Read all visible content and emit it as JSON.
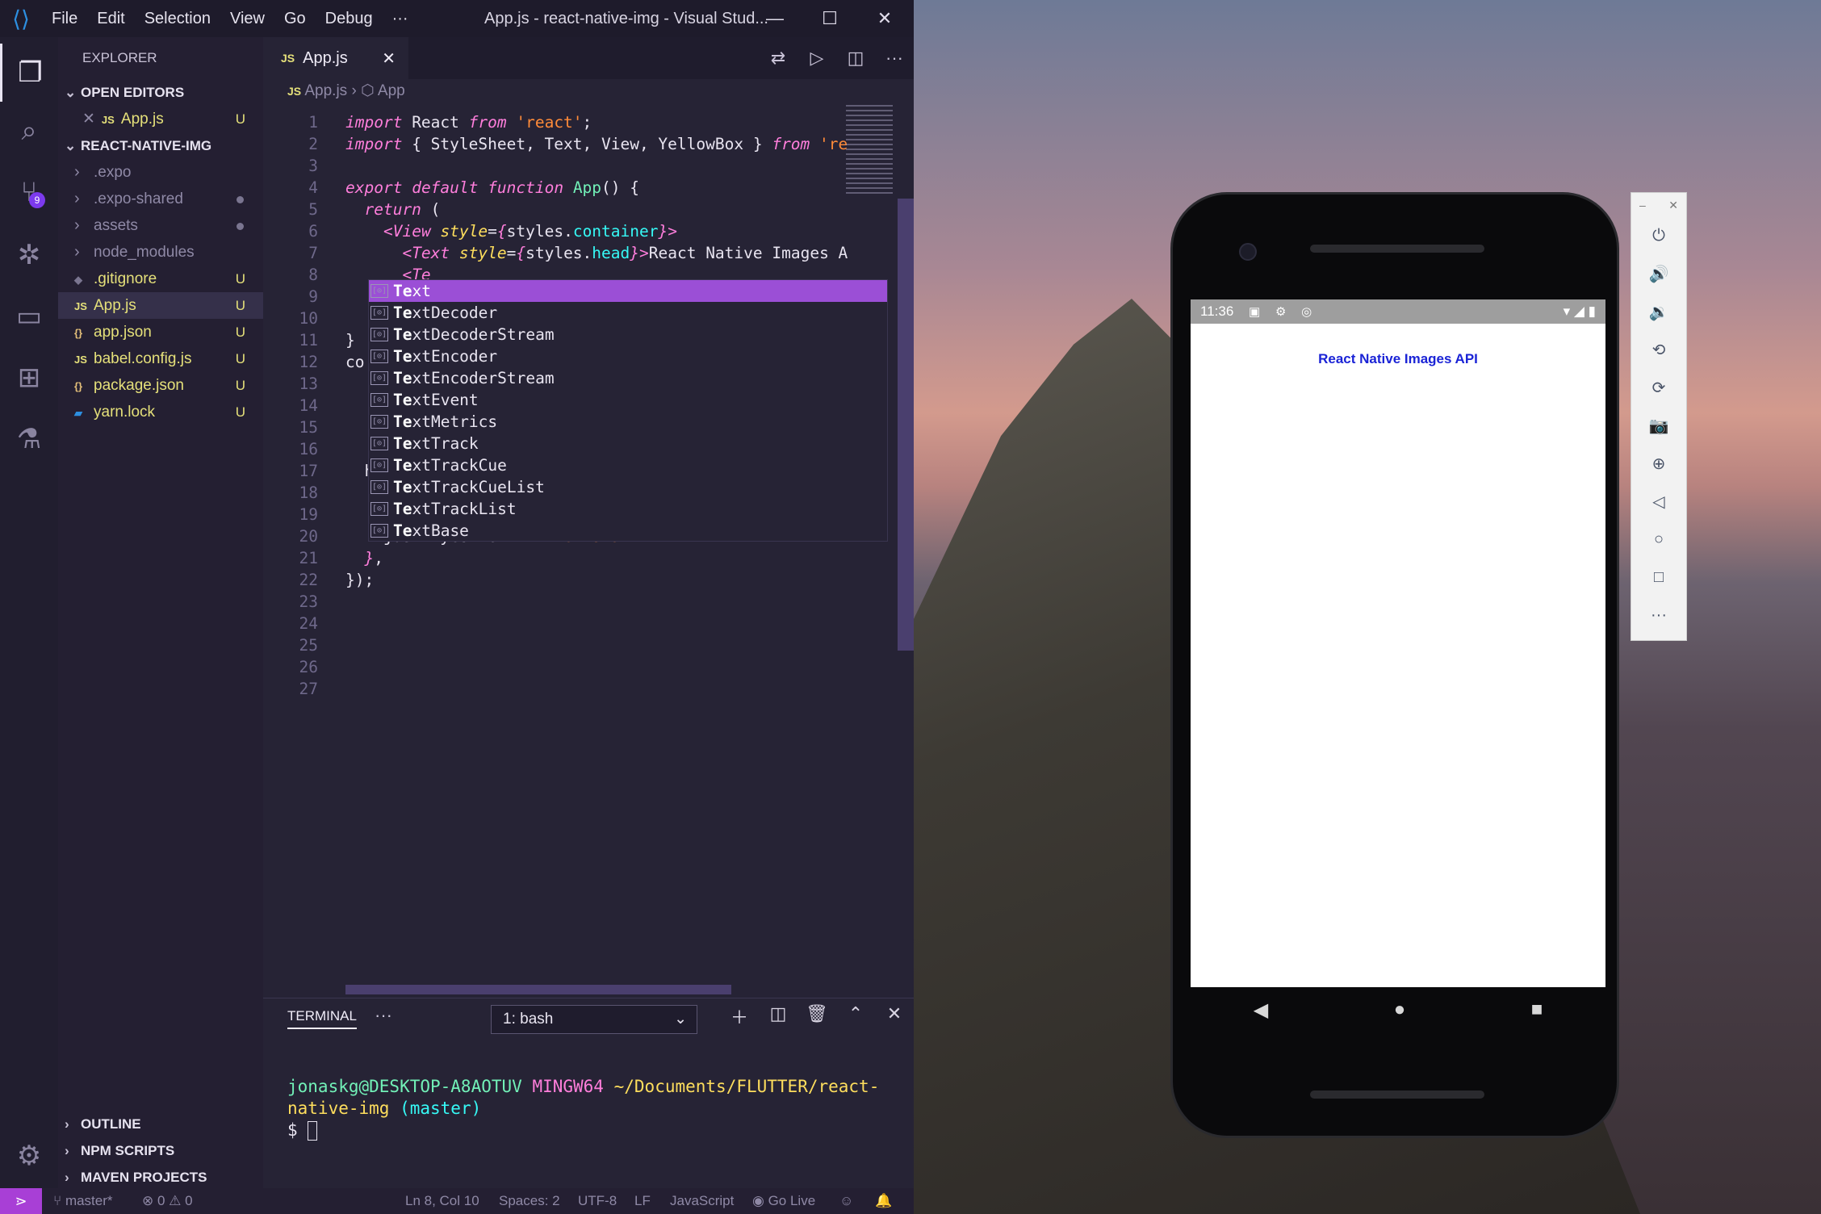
{
  "window": {
    "title": "App.js - react-native-img - Visual Stud...",
    "menu": [
      "File",
      "Edit",
      "Selection",
      "View",
      "Go",
      "Debug",
      "···"
    ],
    "minimize": "—",
    "maximize": "☐",
    "close": "✕"
  },
  "activity_bar": {
    "scm_badge": "9"
  },
  "explorer": {
    "title": "EXPLORER",
    "open_editors_label": "OPEN EDITORS",
    "open_editors": [
      {
        "name": "App.js",
        "status": "U"
      }
    ],
    "project_label": "REACT-NATIVE-IMG",
    "files": [
      {
        "name": ".expo",
        "type": "folder",
        "status": ""
      },
      {
        "name": ".expo-shared",
        "type": "folder",
        "status": "dot"
      },
      {
        "name": "assets",
        "type": "folder",
        "status": "dot"
      },
      {
        "name": "node_modules",
        "type": "folder",
        "status": ""
      },
      {
        "name": ".gitignore",
        "type": "gitignore",
        "status": "U"
      },
      {
        "name": "App.js",
        "type": "js",
        "status": "U"
      },
      {
        "name": "app.json",
        "type": "json",
        "status": "U"
      },
      {
        "name": "babel.config.js",
        "type": "js",
        "status": "U"
      },
      {
        "name": "package.json",
        "type": "json",
        "status": "U"
      },
      {
        "name": "yarn.lock",
        "type": "yarn",
        "status": "U"
      }
    ],
    "bottom_sections": [
      "OUTLINE",
      "NPM SCRIPTS",
      "MAVEN PROJECTS"
    ]
  },
  "editor": {
    "tab_label": "App.js",
    "tab_icon": "JS",
    "breadcrumb": [
      "App.js",
      "App"
    ],
    "line_numbers": [
      "1",
      "2",
      "3",
      "4",
      "5",
      "6",
      "7",
      "8",
      "9",
      "10",
      "11",
      "12",
      "13",
      "14",
      "15",
      "16",
      "17",
      "18",
      "19",
      "20",
      "21",
      "22",
      "23",
      "24",
      "25",
      "26",
      "27"
    ],
    "suggestions": [
      "Text",
      "TextDecoder",
      "TextDecoderStream",
      "TextEncoder",
      "TextEncoderStream",
      "TextEvent",
      "TextMetrics",
      "TextTrack",
      "TextTrackCue",
      "TextTrackCueList",
      "TextTrackList",
      "TextBase"
    ],
    "suggestion_icon": "[⊙]"
  },
  "terminal": {
    "tab_label": "TERMINAL",
    "shell_select": "1: bash",
    "prompt_user": "jonaskg@DESKTOP-A8AOTUV",
    "prompt_env": "MINGW64",
    "prompt_path": "~/Documents/FLUTTER/react-native-img",
    "prompt_branch": "(master)",
    "prompt_symbol": "$"
  },
  "status_bar": {
    "branch": "master*",
    "errors": "⊗ 0 ⚠ 0",
    "position": "Ln 8, Col 10",
    "spaces": "Spaces: 2",
    "encoding": "UTF-8",
    "eol": "LF",
    "language": "JavaScript",
    "golive": "Go Live"
  },
  "emulator": {
    "time": "11:36",
    "app_text": "React Native Images API"
  },
  "colors": {
    "accent": "#9b4fd6",
    "remote": "#a83fd6",
    "editor_bg": "#262335",
    "api_text": "#1a23d6"
  }
}
